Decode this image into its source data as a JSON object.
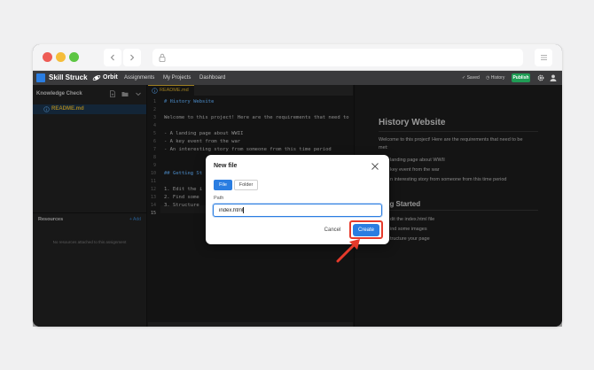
{
  "app": {
    "brand": "Skill Struck",
    "module": "Orbit",
    "nav": [
      "Assignments",
      "My Projects",
      "Dashboard"
    ],
    "saved_label": "Saved",
    "history_label": "History",
    "publish_label": "Publish"
  },
  "sidebar": {
    "title": "Knowledge Check",
    "files": [
      "README.md"
    ],
    "resources_title": "Resources",
    "resources_add": "+ Add",
    "resources_empty": "No resources attached to this assignment"
  },
  "editor": {
    "tab": "README.md",
    "line_numbers": [
      "1",
      "2",
      "3",
      "4",
      "5",
      "6",
      "7",
      "8",
      "9",
      "10",
      "11",
      "12",
      "13",
      "14",
      "15"
    ],
    "lines": [
      "# History Website",
      "",
      "Welcome to this project! Here are the requirements that need to",
      "",
      "- A landing page about WWII",
      "- A key event from the war",
      "- An interesting story from someone from this time period",
      "",
      "",
      "## Getting St",
      "",
      "1. Edit the i",
      "2. Find some",
      "3. Structure",
      ""
    ]
  },
  "preview": {
    "title": "History Website",
    "intro_line1": "Welcome to this project! Here are the requirements that need to be",
    "intro_line2": "met:",
    "bullets": [
      "landing page about WWII",
      "key event from the war",
      "n interesting story from someone from this time period"
    ],
    "h2": "tting Started",
    "steps": [
      "dit the index.html file",
      "ind some images",
      "tructure your page"
    ]
  },
  "modal": {
    "title": "New file",
    "file_tab": "File",
    "folder_tab": "Folder",
    "path_label": "Path",
    "path_value": "index.html",
    "cancel_label": "Cancel",
    "create_label": "Create"
  },
  "colors": {
    "accent": "#2a7de1",
    "highlight": "#e63a2b",
    "publish": "#1f9d55",
    "file_name": "#f1c232"
  }
}
